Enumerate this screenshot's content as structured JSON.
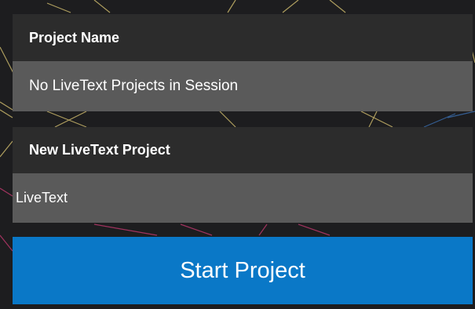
{
  "project_list": {
    "header_label": "Project Name",
    "empty_message": "No LiveText Projects in Session"
  },
  "new_project": {
    "header_label": "New LiveText Project",
    "name_value": "LiveText"
  },
  "actions": {
    "start_label": "Start Project"
  },
  "colors": {
    "header_bg": "#2c2c2c",
    "field_bg": "#5a5a5a",
    "accent": "#0a78c7",
    "background": "#1d1d1f"
  }
}
